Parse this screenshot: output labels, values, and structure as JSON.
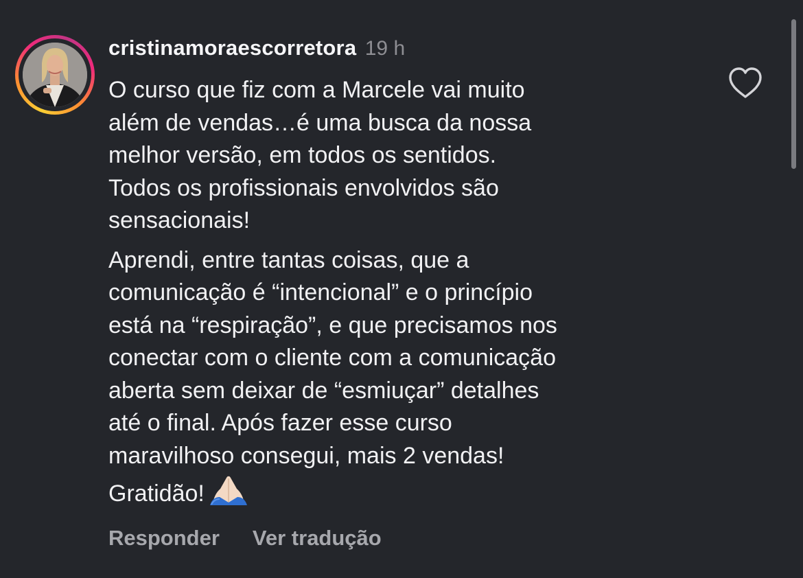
{
  "comment": {
    "username": "cristinamoraescorretora",
    "time": "19 h",
    "paragraphs": [
      "O curso que fiz com a Marcele vai muito\nalém de vendas…é uma busca da nossa\nmelhor versão, em todos os sentidos.\nTodos os profissionais envolvidos são\nsensacionais!",
      "Aprendi, entre tantas coisas, que a\ncomunicação é “intencional” e o princípio\nestá na “respiração”, e que precisamos nos\nconectar com o cliente com a comunicação\naberta sem deixar de “esmiuçar” detalhes\naté o final. Após fazer esse curso\nmaravilhoso consegui,  mais 2 vendas!\nGratidão!"
    ],
    "emoji_icon": "folded-hands-icon",
    "reply_label": "Responder",
    "translate_label": "Ver tradução",
    "like_icon": "heart-outline-icon"
  },
  "colors": {
    "background": "#24262b",
    "text": "#f1f1f3",
    "muted": "#8e8e93",
    "story_ring": [
      "#f9ce34",
      "#fd8d32",
      "#ee2a7b",
      "#c13584"
    ]
  }
}
